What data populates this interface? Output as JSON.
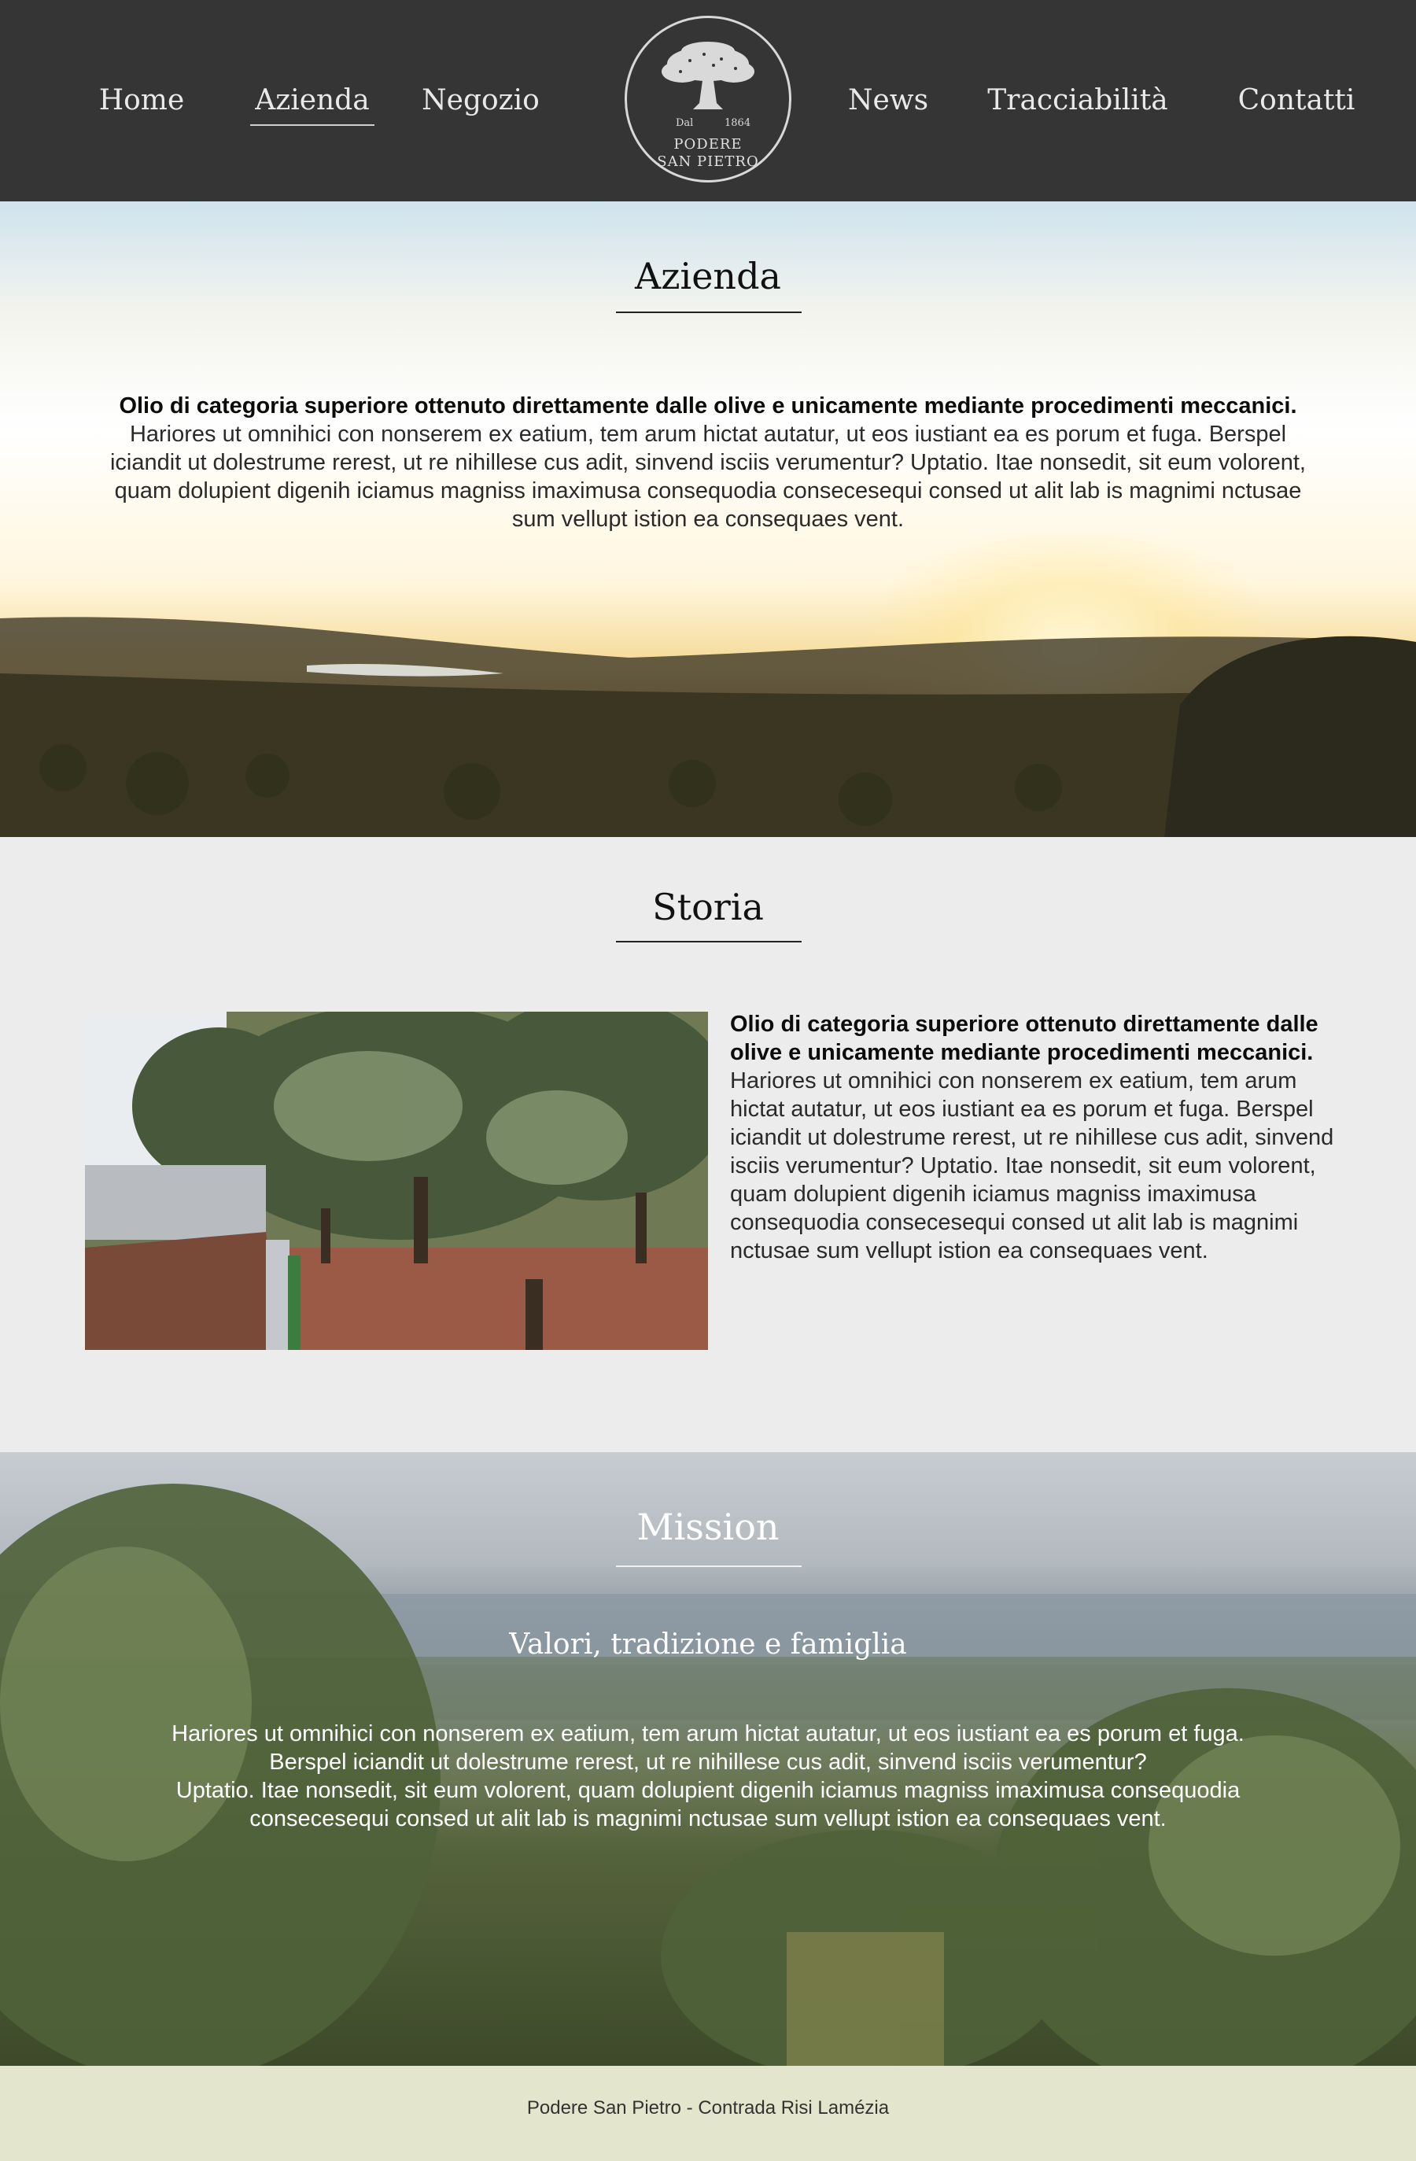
{
  "nav": {
    "left": [
      "Home",
      "Azienda",
      "Negozio"
    ],
    "right": [
      "News",
      "Tracciabilità",
      "Contatti"
    ],
    "active": "Azienda"
  },
  "logo": {
    "since_left": "Dal",
    "since_right": "1864",
    "name_line1": "PODERE",
    "name_line2": "SAN PIETRO",
    "icon": "olive-tree-icon"
  },
  "azienda": {
    "title": "Azienda",
    "lead": "Olio di categoria superiore ottenuto direttamente dalle olive e unicamente mediante procedimenti meccanici.",
    "body": "Hariores ut omnihici con nonserem ex eatium, tem arum hictat autatur, ut eos iustiant ea es porum et fuga. Berspel iciandit ut dolestrume rerest, ut re nihillese cus adit, sinvend isciis verumentur? Uptatio. Itae nonsedit, sit eum volorent, quam dolupient digenih iciamus magniss imaximusa consequodia consecesequi consed ut alit lab is magnimi nctusae sum vellupt istion ea consequaes vent."
  },
  "storia": {
    "title": "Storia",
    "lead": "Olio di categoria superiore ottenuto direttamente dalle olive e unicamente mediante procedimenti meccanici.",
    "body": "Hariores ut omnihici con nonserem ex eatium, tem arum hictat autatur, ut eos iustiant ea es porum et fuga. Berspel iciandit ut dolestrume rerest, ut re nihillese cus adit, sinvend isciis verumentur? Uptatio. Itae nonsedit, sit eum volorent, quam dolupient digenih iciamus magniss imaximusa consequodia consecesequi consed ut alit lab is magnimi nctusae sum vellupt istion ea consequaes vent."
  },
  "mission": {
    "title": "Mission",
    "subtitle": "Valori, tradizione e famiglia",
    "para1": "Hariores ut omnihici con nonserem ex eatium, tem arum hictat autatur, ut eos iustiant ea es porum et fuga. Berspel iciandit ut dolestrume rerest, ut re nihillese cus adit, sinvend isciis verumentur?",
    "para2": "Uptatio. Itae nonsedit, sit eum volorent, quam dolupient digenih iciamus magniss imaximusa consequodia consecesequi consed ut alit lab is magnimi nctusae sum vellupt istion ea consequaes vent."
  },
  "footer": {
    "text": "Podere San Pietro - Contrada Risi Lamézia"
  }
}
